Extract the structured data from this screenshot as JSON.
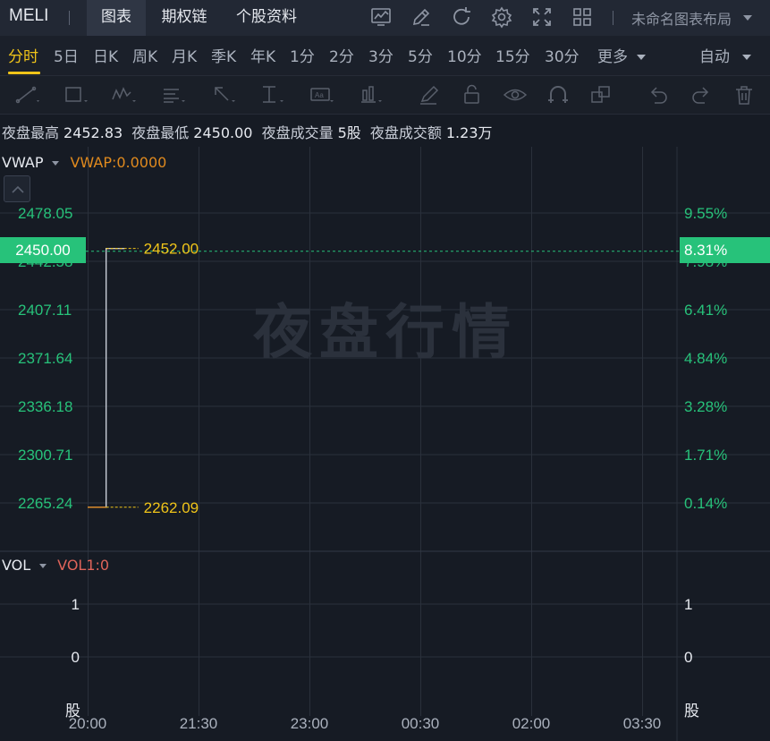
{
  "header": {
    "ticker": "MELI",
    "tabs": [
      {
        "label": "图表",
        "active": true
      },
      {
        "label": "期权链",
        "active": false
      },
      {
        "label": "个股资料",
        "active": false
      }
    ],
    "icons": [
      "indicator-icon",
      "draw-icon",
      "refresh-icon",
      "settings-icon",
      "fullscreen-icon",
      "layout-grid-icon"
    ],
    "layout_name": "未命名图表布局"
  },
  "periods": [
    {
      "label": "分时",
      "active": true
    },
    {
      "label": "5日"
    },
    {
      "label": "日K"
    },
    {
      "label": "周K"
    },
    {
      "label": "月K"
    },
    {
      "label": "季K"
    },
    {
      "label": "年K"
    },
    {
      "label": "1分"
    },
    {
      "label": "2分"
    },
    {
      "label": "3分"
    },
    {
      "label": "5分"
    },
    {
      "label": "10分"
    },
    {
      "label": "15分"
    },
    {
      "label": "30分"
    },
    {
      "label": "更多"
    }
  ],
  "scale_mode": "自动",
  "draw_tools": [
    "line-tool-icon",
    "rectangle-tool-icon",
    "pattern-tool-icon",
    "fib-tool-icon",
    "arrow-tool-icon",
    "measure-tool-icon",
    "text-tool-icon",
    "bar-tool-icon",
    "brush-icon",
    "lock-icon",
    "eye-icon",
    "magnet-icon",
    "layers-icon",
    "undo-icon",
    "redo-icon",
    "trash-icon"
  ],
  "info": {
    "high_label": "夜盘最高",
    "high_value": "2452.83",
    "low_label": "夜盘最低",
    "low_value": "2450.00",
    "volume_label": "夜盘成交量",
    "volume_value": "5股",
    "turnover_label": "夜盘成交额",
    "turnover_value": "1.23万"
  },
  "indicator": {
    "name": "VWAP",
    "value": "VWAP:0.0000",
    "value_color": "#e08a1e"
  },
  "volume_indicator": {
    "name": "VOL",
    "value": "VOL1:0",
    "value_color": "#e0645a"
  },
  "watermark": "夜盘行情",
  "current_price": "2450.00",
  "current_pct": "8.31%",
  "colors": {
    "up": "#27c27a",
    "axis_text": "#27c27a",
    "marker": "#f0c419",
    "price_line": "#c9ced8"
  },
  "chart_data": {
    "type": "line",
    "x_ticks": [
      "20:00",
      "21:30",
      "23:00",
      "00:30",
      "02:00",
      "03:30"
    ],
    "y_ticks": [
      "2478.05",
      "2442.58",
      "2407.11",
      "2371.64",
      "2336.18",
      "2300.71",
      "2265.24"
    ],
    "pct_ticks": [
      "9.55%",
      "7.98%",
      "6.41%",
      "4.84%",
      "3.28%",
      "1.71%",
      "0.14%"
    ],
    "ylim": [
      2265.24,
      2478.05
    ],
    "series": [
      {
        "x": [
          "20:00",
          "20:15",
          "20:15",
          "20:30"
        ],
        "y": [
          2262.09,
          2262.09,
          2452.0,
          2452.0
        ]
      }
    ],
    "high_marker": "2452.00",
    "low_marker": "2262.09",
    "last_price": 2450.0,
    "volume_ticks": [
      "1",
      "0"
    ],
    "volume_unit": "股"
  }
}
